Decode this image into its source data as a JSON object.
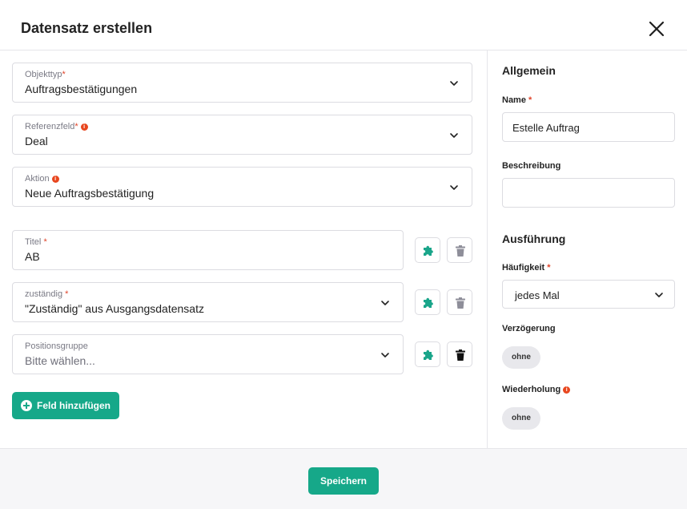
{
  "dialog": {
    "title": "Datensatz erstellen"
  },
  "left": {
    "fields": [
      {
        "label": "Objekttyp",
        "required_mark": "*",
        "value": "Auftragsbestätigungen"
      },
      {
        "label": "Referenzfeld",
        "required_mark": "*",
        "value": "Deal"
      },
      {
        "label": "Aktion",
        "required_mark": "",
        "value": "Neue Auftragsbestätigung"
      },
      {
        "label": "Titel",
        "required_mark": "*",
        "value": "AB"
      },
      {
        "label": "zuständig",
        "required_mark": "*",
        "value": "\"Zuständig\" aus Ausgangsdatensatz"
      },
      {
        "label": "Positionsgruppe",
        "required_mark": "",
        "placeholder": "Bitte wählen..."
      }
    ],
    "add_field_label": "Feld hinzufügen"
  },
  "right": {
    "general_title": "Allgemein",
    "name_label": "Name",
    "name_required_mark": "*",
    "name_value": "Estelle Auftrag",
    "description_label": "Beschreibung",
    "description_value": "",
    "execution_title": "Ausführung",
    "frequency_label": "Häufigkeit",
    "frequency_required_mark": "*",
    "frequency_value": "jedes Mal",
    "delay_label": "Verzögerung",
    "delay_value": "ohne",
    "repeat_label": "Wiederholung",
    "repeat_value": "ohne"
  },
  "footer": {
    "save_label": "Speichern"
  },
  "colors": {
    "accent": "#16a889",
    "required": "#e0452b",
    "info": "#e8461e",
    "icon_teal": "#1aa58a",
    "trash_disabled": "#8e8e99",
    "trash_active": "#111111"
  },
  "icons": {
    "close": "close-icon",
    "chevron": "chevron-down-icon",
    "puzzle": "puzzle-icon",
    "trash": "trash-icon",
    "info": "info-icon",
    "add": "plus-circle-icon"
  }
}
